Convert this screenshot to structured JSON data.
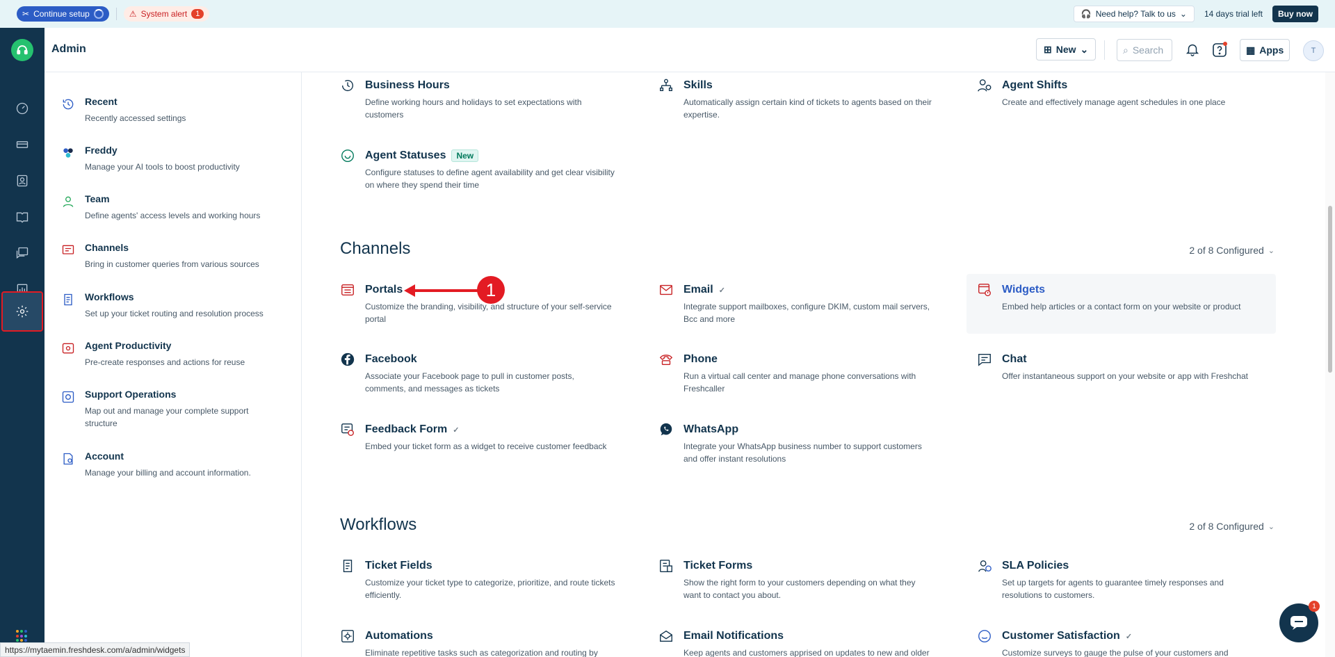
{
  "banner": {
    "setup_label": "Continue setup",
    "alert_label": "System alert",
    "alert_count": "1",
    "help_label": "Need help? Talk to us",
    "trial_text": "14 days trial left",
    "buy_label": "Buy now"
  },
  "header": {
    "title": "Admin",
    "new_label": "New",
    "search_placeholder": "Search",
    "apps_label": "Apps",
    "avatar_initial": "T"
  },
  "sidebar": {
    "items": [
      {
        "label": "Recent",
        "desc": "Recently accessed settings",
        "icon": "history-icon"
      },
      {
        "label": "Freddy",
        "desc": "Manage your AI tools to boost productivity",
        "icon": "freddy-icon"
      },
      {
        "label": "Team",
        "desc": "Define agents' access levels and working hours",
        "icon": "team-icon"
      },
      {
        "label": "Channels",
        "desc": "Bring in customer queries from various sources",
        "icon": "channels-icon"
      },
      {
        "label": "Workflows",
        "desc": "Set up your ticket routing and resolution process",
        "icon": "workflows-icon"
      },
      {
        "label": "Agent Productivity",
        "desc": "Pre-create responses and actions for reuse",
        "icon": "productivity-icon"
      },
      {
        "label": "Support Operations",
        "desc": "Map out and manage your complete support structure",
        "icon": "support-ops-icon"
      },
      {
        "label": "Account",
        "desc": "Manage your billing and account information.",
        "icon": "account-icon"
      }
    ]
  },
  "team_cards": [
    {
      "label": "Business Hours",
      "desc": "Define working hours and holidays to set expectations with customers"
    },
    {
      "label": "Skills",
      "desc": "Automatically assign certain kind of tickets to agents based on their expertise."
    },
    {
      "label": "Agent Shifts",
      "desc": "Create and effectively manage agent schedules in one place"
    },
    {
      "label": "Agent Statuses",
      "desc": "Configure statuses to define agent availability and get clear visibility on where they spend their time",
      "tag": "New"
    }
  ],
  "channels": {
    "title": "Channels",
    "configured": "2 of 8 Configured",
    "cards": [
      {
        "label": "Portals",
        "desc": "Customize the branding, visibility, and structure of your self-service portal"
      },
      {
        "label": "Email",
        "desc": "Integrate support mailboxes, configure DKIM, custom mail servers, Bcc and more"
      },
      {
        "label": "Widgets",
        "desc": "Embed help articles or a contact form on your website or product"
      },
      {
        "label": "Facebook",
        "desc": "Associate your Facebook page to pull in customer posts, comments, and messages as tickets"
      },
      {
        "label": "Phone",
        "desc": "Run a virtual call center and manage phone conversations with Freshcaller"
      },
      {
        "label": "Chat",
        "desc": "Offer instantaneous support on your website or app with Freshchat"
      },
      {
        "label": "Feedback Form",
        "desc": "Embed your ticket form as a widget to receive customer feedback"
      },
      {
        "label": "WhatsApp",
        "desc": "Integrate your WhatsApp business number to support customers and offer instant resolutions"
      }
    ]
  },
  "workflows": {
    "title": "Workflows",
    "configured": "2 of 8 Configured",
    "cards": [
      {
        "label": "Ticket Fields",
        "desc": "Customize your ticket type to categorize, prioritize, and route tickets efficiently."
      },
      {
        "label": "Ticket Forms",
        "desc": "Show the right form to your customers depending on what they want to contact you about."
      },
      {
        "label": "SLA Policies",
        "desc": "Set up targets for agents to guarantee timely responses and resolutions to customers."
      },
      {
        "label": "Automations",
        "desc": "Eliminate repetitive tasks such as categorization and routing by"
      },
      {
        "label": "Email Notifications",
        "desc": "Keep agents and customers apprised on updates to new and older"
      },
      {
        "label": "Customer Satisfaction",
        "desc": "Customize surveys to gauge the pulse of your customers and"
      }
    ]
  },
  "annotation": {
    "number": "1"
  },
  "status_url": "https://mytaemin.freshdesk.com/a/admin/widgets",
  "chat_badge": "1",
  "colors": {
    "rail": "#12344d",
    "accent": "#2c5cc5",
    "alert": "#e4412a",
    "highlight_outline": "#e31b23"
  }
}
